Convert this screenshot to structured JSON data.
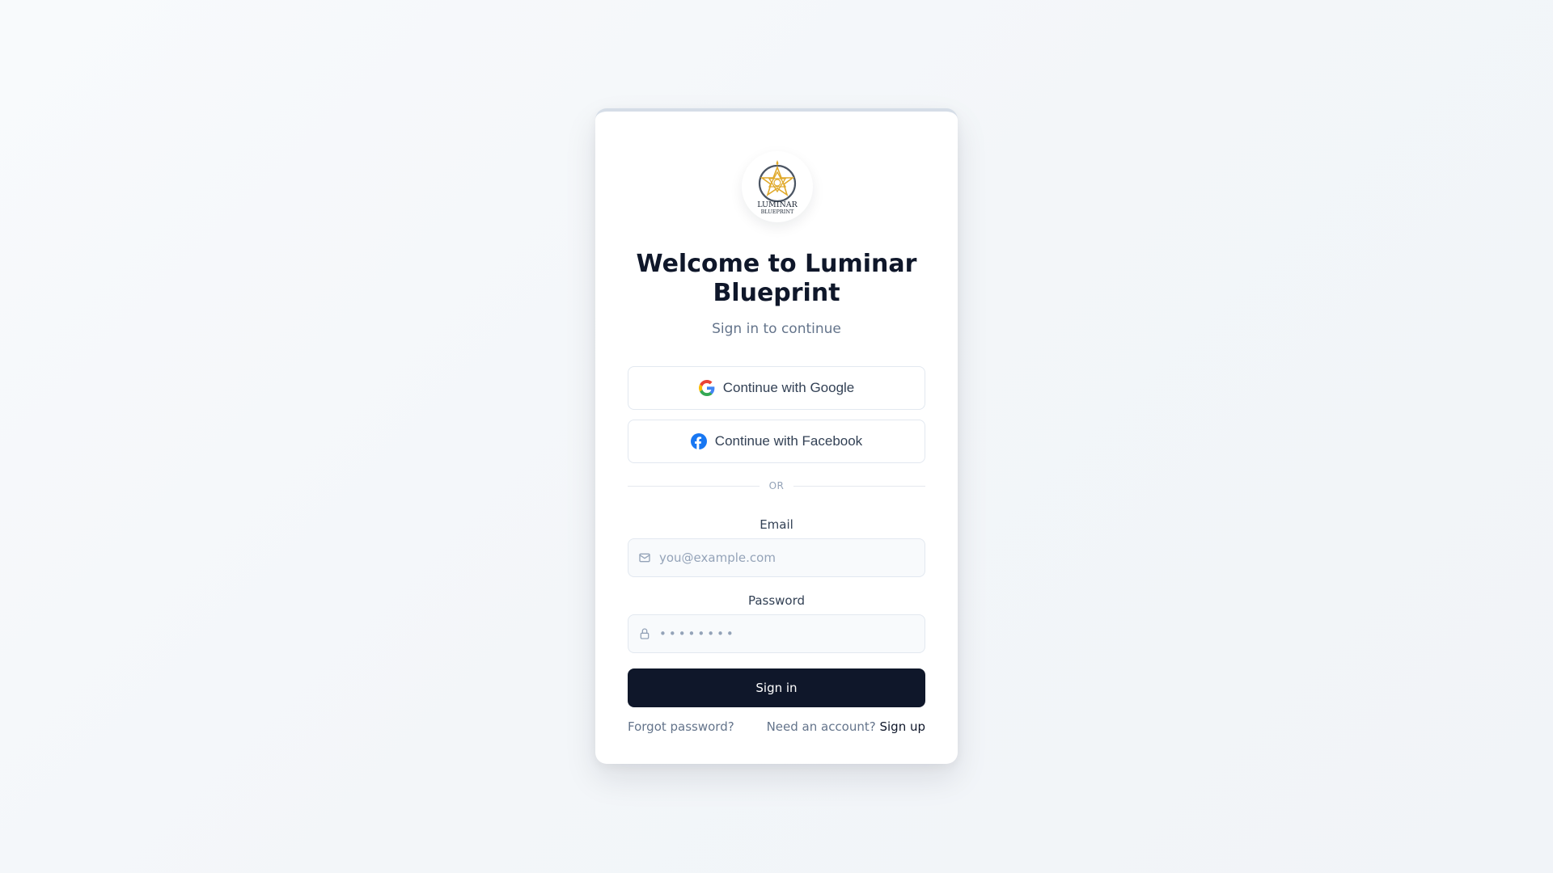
{
  "brand": {
    "logo_icon": "luminar-blueprint-logo",
    "logo_text_top": "LUMINAR",
    "logo_text_bottom": "BLUEPRINT"
  },
  "header": {
    "title_line1": "Welcome to Luminar",
    "title_line2": "Blueprint",
    "subtitle": "Sign in to continue"
  },
  "oauth": {
    "google_label": "Continue with Google",
    "google_icon": "google-icon",
    "facebook_label": "Continue with Facebook",
    "facebook_icon": "facebook-icon"
  },
  "divider": {
    "text": "OR"
  },
  "form": {
    "email_label": "Email",
    "email_placeholder": "you@example.com",
    "email_value": "",
    "email_icon": "mail-icon",
    "password_label": "Password",
    "password_placeholder": "••••••••",
    "password_value": "",
    "password_icon": "lock-icon",
    "submit_label": "Sign in"
  },
  "footer": {
    "forgot_label": "Forgot password?",
    "need_account_text": "Need an account?",
    "signup_label": "Sign up"
  },
  "colors": {
    "primary": "#0f172a",
    "muted": "#64748b",
    "border": "#e2e8f0",
    "logo_gold": "#e0a92a",
    "facebook_blue": "#1877f2"
  }
}
